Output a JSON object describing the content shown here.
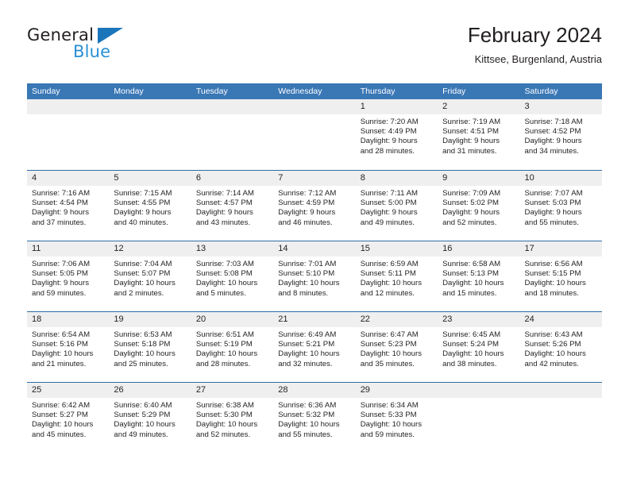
{
  "brand": {
    "name_part1": "General",
    "name_part2": "Blue",
    "triangle_color": "#1b75bb",
    "blue_text_color": "#2a8fd4"
  },
  "header": {
    "title": "February 2024",
    "subtitle": "Kittsee, Burgenland, Austria"
  },
  "theme": {
    "header_blue": "#3a77b5",
    "row_divider_blue": "#2e6da4",
    "day_band_gray": "#efefef",
    "text_color": "#231f20"
  },
  "weekdays": [
    "Sunday",
    "Monday",
    "Tuesday",
    "Wednesday",
    "Thursday",
    "Friday",
    "Saturday"
  ],
  "weeks": [
    [
      {
        "day": "",
        "lines": []
      },
      {
        "day": "",
        "lines": []
      },
      {
        "day": "",
        "lines": []
      },
      {
        "day": "",
        "lines": []
      },
      {
        "day": "1",
        "lines": [
          "Sunrise: 7:20 AM",
          "Sunset: 4:49 PM",
          "Daylight: 9 hours",
          "and 28 minutes."
        ]
      },
      {
        "day": "2",
        "lines": [
          "Sunrise: 7:19 AM",
          "Sunset: 4:51 PM",
          "Daylight: 9 hours",
          "and 31 minutes."
        ]
      },
      {
        "day": "3",
        "lines": [
          "Sunrise: 7:18 AM",
          "Sunset: 4:52 PM",
          "Daylight: 9 hours",
          "and 34 minutes."
        ]
      }
    ],
    [
      {
        "day": "4",
        "lines": [
          "Sunrise: 7:16 AM",
          "Sunset: 4:54 PM",
          "Daylight: 9 hours",
          "and 37 minutes."
        ]
      },
      {
        "day": "5",
        "lines": [
          "Sunrise: 7:15 AM",
          "Sunset: 4:55 PM",
          "Daylight: 9 hours",
          "and 40 minutes."
        ]
      },
      {
        "day": "6",
        "lines": [
          "Sunrise: 7:14 AM",
          "Sunset: 4:57 PM",
          "Daylight: 9 hours",
          "and 43 minutes."
        ]
      },
      {
        "day": "7",
        "lines": [
          "Sunrise: 7:12 AM",
          "Sunset: 4:59 PM",
          "Daylight: 9 hours",
          "and 46 minutes."
        ]
      },
      {
        "day": "8",
        "lines": [
          "Sunrise: 7:11 AM",
          "Sunset: 5:00 PM",
          "Daylight: 9 hours",
          "and 49 minutes."
        ]
      },
      {
        "day": "9",
        "lines": [
          "Sunrise: 7:09 AM",
          "Sunset: 5:02 PM",
          "Daylight: 9 hours",
          "and 52 minutes."
        ]
      },
      {
        "day": "10",
        "lines": [
          "Sunrise: 7:07 AM",
          "Sunset: 5:03 PM",
          "Daylight: 9 hours",
          "and 55 minutes."
        ]
      }
    ],
    [
      {
        "day": "11",
        "lines": [
          "Sunrise: 7:06 AM",
          "Sunset: 5:05 PM",
          "Daylight: 9 hours",
          "and 59 minutes."
        ]
      },
      {
        "day": "12",
        "lines": [
          "Sunrise: 7:04 AM",
          "Sunset: 5:07 PM",
          "Daylight: 10 hours",
          "and 2 minutes."
        ]
      },
      {
        "day": "13",
        "lines": [
          "Sunrise: 7:03 AM",
          "Sunset: 5:08 PM",
          "Daylight: 10 hours",
          "and 5 minutes."
        ]
      },
      {
        "day": "14",
        "lines": [
          "Sunrise: 7:01 AM",
          "Sunset: 5:10 PM",
          "Daylight: 10 hours",
          "and 8 minutes."
        ]
      },
      {
        "day": "15",
        "lines": [
          "Sunrise: 6:59 AM",
          "Sunset: 5:11 PM",
          "Daylight: 10 hours",
          "and 12 minutes."
        ]
      },
      {
        "day": "16",
        "lines": [
          "Sunrise: 6:58 AM",
          "Sunset: 5:13 PM",
          "Daylight: 10 hours",
          "and 15 minutes."
        ]
      },
      {
        "day": "17",
        "lines": [
          "Sunrise: 6:56 AM",
          "Sunset: 5:15 PM",
          "Daylight: 10 hours",
          "and 18 minutes."
        ]
      }
    ],
    [
      {
        "day": "18",
        "lines": [
          "Sunrise: 6:54 AM",
          "Sunset: 5:16 PM",
          "Daylight: 10 hours",
          "and 21 minutes."
        ]
      },
      {
        "day": "19",
        "lines": [
          "Sunrise: 6:53 AM",
          "Sunset: 5:18 PM",
          "Daylight: 10 hours",
          "and 25 minutes."
        ]
      },
      {
        "day": "20",
        "lines": [
          "Sunrise: 6:51 AM",
          "Sunset: 5:19 PM",
          "Daylight: 10 hours",
          "and 28 minutes."
        ]
      },
      {
        "day": "21",
        "lines": [
          "Sunrise: 6:49 AM",
          "Sunset: 5:21 PM",
          "Daylight: 10 hours",
          "and 32 minutes."
        ]
      },
      {
        "day": "22",
        "lines": [
          "Sunrise: 6:47 AM",
          "Sunset: 5:23 PM",
          "Daylight: 10 hours",
          "and 35 minutes."
        ]
      },
      {
        "day": "23",
        "lines": [
          "Sunrise: 6:45 AM",
          "Sunset: 5:24 PM",
          "Daylight: 10 hours",
          "and 38 minutes."
        ]
      },
      {
        "day": "24",
        "lines": [
          "Sunrise: 6:43 AM",
          "Sunset: 5:26 PM",
          "Daylight: 10 hours",
          "and 42 minutes."
        ]
      }
    ],
    [
      {
        "day": "25",
        "lines": [
          "Sunrise: 6:42 AM",
          "Sunset: 5:27 PM",
          "Daylight: 10 hours",
          "and 45 minutes."
        ]
      },
      {
        "day": "26",
        "lines": [
          "Sunrise: 6:40 AM",
          "Sunset: 5:29 PM",
          "Daylight: 10 hours",
          "and 49 minutes."
        ]
      },
      {
        "day": "27",
        "lines": [
          "Sunrise: 6:38 AM",
          "Sunset: 5:30 PM",
          "Daylight: 10 hours",
          "and 52 minutes."
        ]
      },
      {
        "day": "28",
        "lines": [
          "Sunrise: 6:36 AM",
          "Sunset: 5:32 PM",
          "Daylight: 10 hours",
          "and 55 minutes."
        ]
      },
      {
        "day": "29",
        "lines": [
          "Sunrise: 6:34 AM",
          "Sunset: 5:33 PM",
          "Daylight: 10 hours",
          "and 59 minutes."
        ]
      },
      {
        "day": "",
        "lines": []
      },
      {
        "day": "",
        "lines": []
      }
    ]
  ]
}
